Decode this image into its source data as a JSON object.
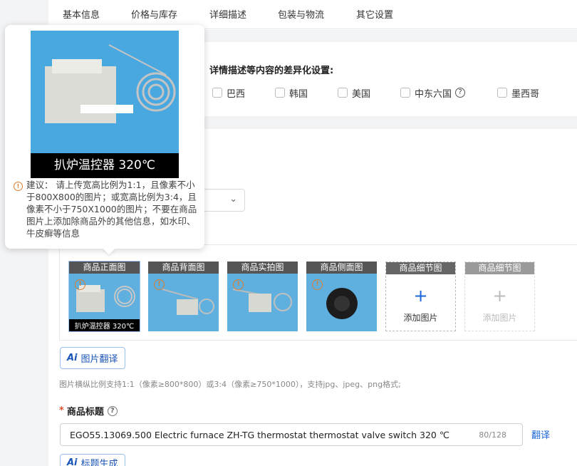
{
  "tabs": [
    "基本信息",
    "价格与库存",
    "详细描述",
    "包装与物流",
    "其它设置"
  ],
  "diff_settings": {
    "title": "详情描述等内容的差异化设置:",
    "countries": [
      "巴西",
      "韩国",
      "美国",
      "中东六国",
      "墨西哥"
    ]
  },
  "images": {
    "slots": [
      {
        "label": "商品正面图",
        "caption": "扒炉温控器  320℃"
      },
      {
        "label": "商品背面图"
      },
      {
        "label": "商品实拍图"
      },
      {
        "label": "商品侧面图"
      },
      {
        "label": "商品细节图",
        "add_text": "添加图片"
      },
      {
        "label": "商品细节图",
        "add_text": "添加图片"
      }
    ],
    "translate_button": "图片翻译",
    "hint": "图片横纵比例支持1:1（像素≥800*800）或3:4（像素≥750*1000），支持jpg、jpeg、png格式;"
  },
  "product_title": {
    "label": "商品标题",
    "value": "EGO55.13069.500 Electric furnace ZH-TG thermostat thermostat valve switch 320 ℃",
    "count": "80/128",
    "translate_link": "翻译",
    "generate_button": "标题生成"
  },
  "popover": {
    "caption": "扒炉温控器  320℃",
    "tip": "建议：  请上传宽高比例为1:1，且像素不小于800X800的图片；或宽高比例为3:4，且像素不小于750X1000的图片；不要在商品图片上添加除商品外的其他信息，如水印、牛皮癣等信息"
  },
  "colors": {
    "accent": "#1a66d9",
    "warning": "#e07b2c",
    "required": "#e04e2e"
  }
}
